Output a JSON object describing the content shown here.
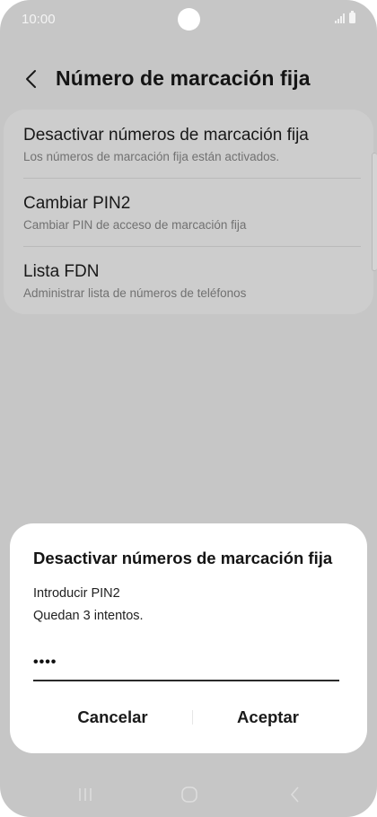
{
  "status_bar": {
    "time": "10:00"
  },
  "header": {
    "title": "Número de marcación fija"
  },
  "settings": {
    "items": [
      {
        "title": "Desactivar números de marcación fija",
        "subtitle": "Los números de marcación fija están activados."
      },
      {
        "title": "Cambiar PIN2",
        "subtitle": "Cambiar PIN de acceso de marcación fija"
      },
      {
        "title": "Lista FDN",
        "subtitle": "Administrar lista de números de teléfonos"
      }
    ]
  },
  "dialog": {
    "title": "Desactivar números de marcación fija",
    "line1": "Introducir PIN2",
    "line2": "Quedan 3 intentos.",
    "pin_value": "••••",
    "cancel_label": "Cancelar",
    "accept_label": "Aceptar"
  },
  "icons": {
    "back": "chevron-left-icon",
    "nav_recents": "recent-apps-icon",
    "nav_home": "home-icon",
    "nav_back": "nav-back-icon"
  },
  "colors": {
    "dim_background": "#c6c6c6",
    "card_background": "#cdcdcd",
    "dialog_background": "#ffffff",
    "text_primary": "#141414",
    "text_secondary": "#717171"
  }
}
